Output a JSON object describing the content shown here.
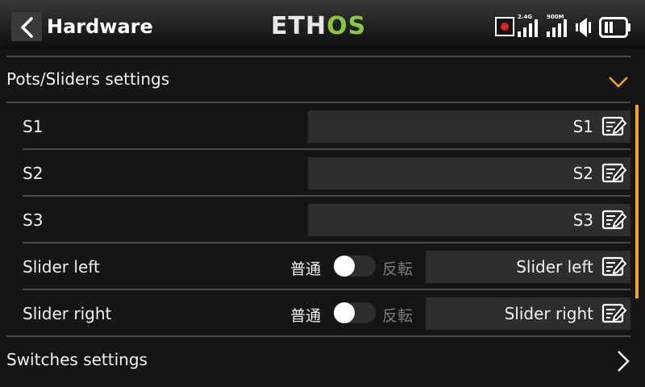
{
  "header": {
    "title": "Hardware",
    "logo_eth": "ETH",
    "logo_os": "OS",
    "signal_24_label": "2.4G",
    "signal_900_label": "900M"
  },
  "colors": {
    "accent": "#f5a623",
    "logo_green": "#8cc63f",
    "record_red": "#e0201c"
  },
  "sections": {
    "pots": {
      "label": "Pots/Sliders settings",
      "expanded": true
    },
    "switches": {
      "label": "Switches settings",
      "expanded": false
    }
  },
  "items": [
    {
      "label": "S1",
      "value": "S1"
    },
    {
      "label": "S2",
      "value": "S2"
    },
    {
      "label": "S3",
      "value": "S3"
    },
    {
      "label": "Slider left",
      "value": "Slider left",
      "toggle_left": "普通",
      "toggle_right": "反転",
      "toggle_on": false
    },
    {
      "label": "Slider right",
      "value": "Slider right",
      "toggle_left": "普通",
      "toggle_right": "反転",
      "toggle_on": false
    }
  ]
}
